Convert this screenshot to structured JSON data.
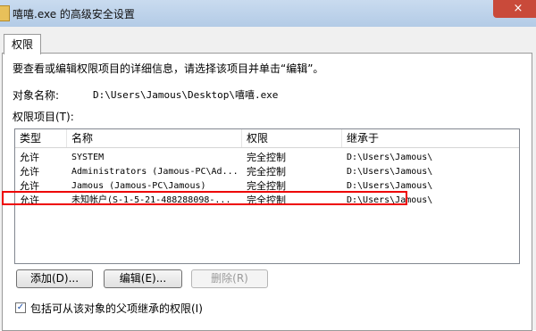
{
  "window": {
    "title": "嘻嘻.exe 的高级安全设置",
    "close_label": "×"
  },
  "tabs": [
    {
      "label": "权限"
    }
  ],
  "permissions": {
    "description": "要查看或编辑权限项目的详细信息，请选择该项目并单击“编辑”。",
    "object_name_label": "对象名称:",
    "object_name_value": "D:\\Users\\Jamous\\Desktop\\嘻嘻.exe",
    "entries_label": "权限项目(T):",
    "columns": [
      "类型",
      "名称",
      "权限",
      "继承于"
    ],
    "rows": [
      {
        "type": "允许",
        "name": "SYSTEM",
        "permission": "完全控制",
        "inherited_from": "D:\\Users\\Jamous\\"
      },
      {
        "type": "允许",
        "name": "Administrators (Jamous-PC\\Ad...",
        "permission": "完全控制",
        "inherited_from": "D:\\Users\\Jamous\\"
      },
      {
        "type": "允许",
        "name": "Jamous (Jamous-PC\\Jamous)",
        "permission": "完全控制",
        "inherited_from": "D:\\Users\\Jamous\\"
      },
      {
        "type": "允许",
        "name": "未知帐户(S-1-5-21-488288098-...",
        "permission": "完全控制",
        "inherited_from": "D:\\Users\\Jamous\\"
      }
    ],
    "buttons": {
      "add": "添加(D)...",
      "edit": "编辑(E)...",
      "remove": "删除(R)"
    },
    "inherit_checkbox": {
      "label": "包括可从该对象的父项继承的权限(I)",
      "checked": true
    }
  }
}
